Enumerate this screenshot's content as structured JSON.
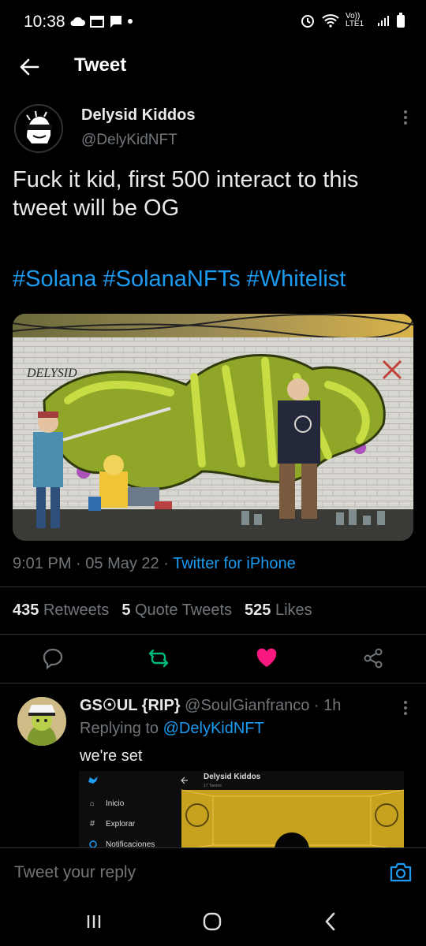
{
  "status_bar": {
    "time": "10:38",
    "network": "Vo)) LTE1"
  },
  "app_bar": {
    "title": "Tweet"
  },
  "tweet": {
    "author_name": "Delysid Kiddos",
    "author_handle": "@DelyKidNFT",
    "text": "Fuck it kid, first 500 interact to this tweet will be OG",
    "hashtags": "#Solana #SolanaNFTs #Whitelist",
    "image_text": "DELYSID",
    "time": "9:01 PM",
    "date": "05 May 22",
    "source": "Twitter for iPhone",
    "retweets_count": "435",
    "retweets_label": "Retweets",
    "quotes_count": "5",
    "quotes_label": "Quote Tweets",
    "likes_count": "525",
    "likes_label": "Likes",
    "liked": true
  },
  "reply": {
    "author_name": "GS☉UL {RIP}",
    "author_handle": "@SoulGianfranco",
    "time": "1h",
    "replying_prefix": "Replying to",
    "replying_to": "@DelyKidNFT",
    "text": "we're set",
    "preview": {
      "menu": [
        "Inicio",
        "Explorar",
        "Notificaciones"
      ],
      "title": "Delysid Kiddos",
      "subtitle": "17 Tweets"
    }
  },
  "composer": {
    "placeholder": "Tweet your reply"
  },
  "colors": {
    "accent": "#1d9bf0",
    "like": "#f91880",
    "retweet": "#00ba7c"
  }
}
